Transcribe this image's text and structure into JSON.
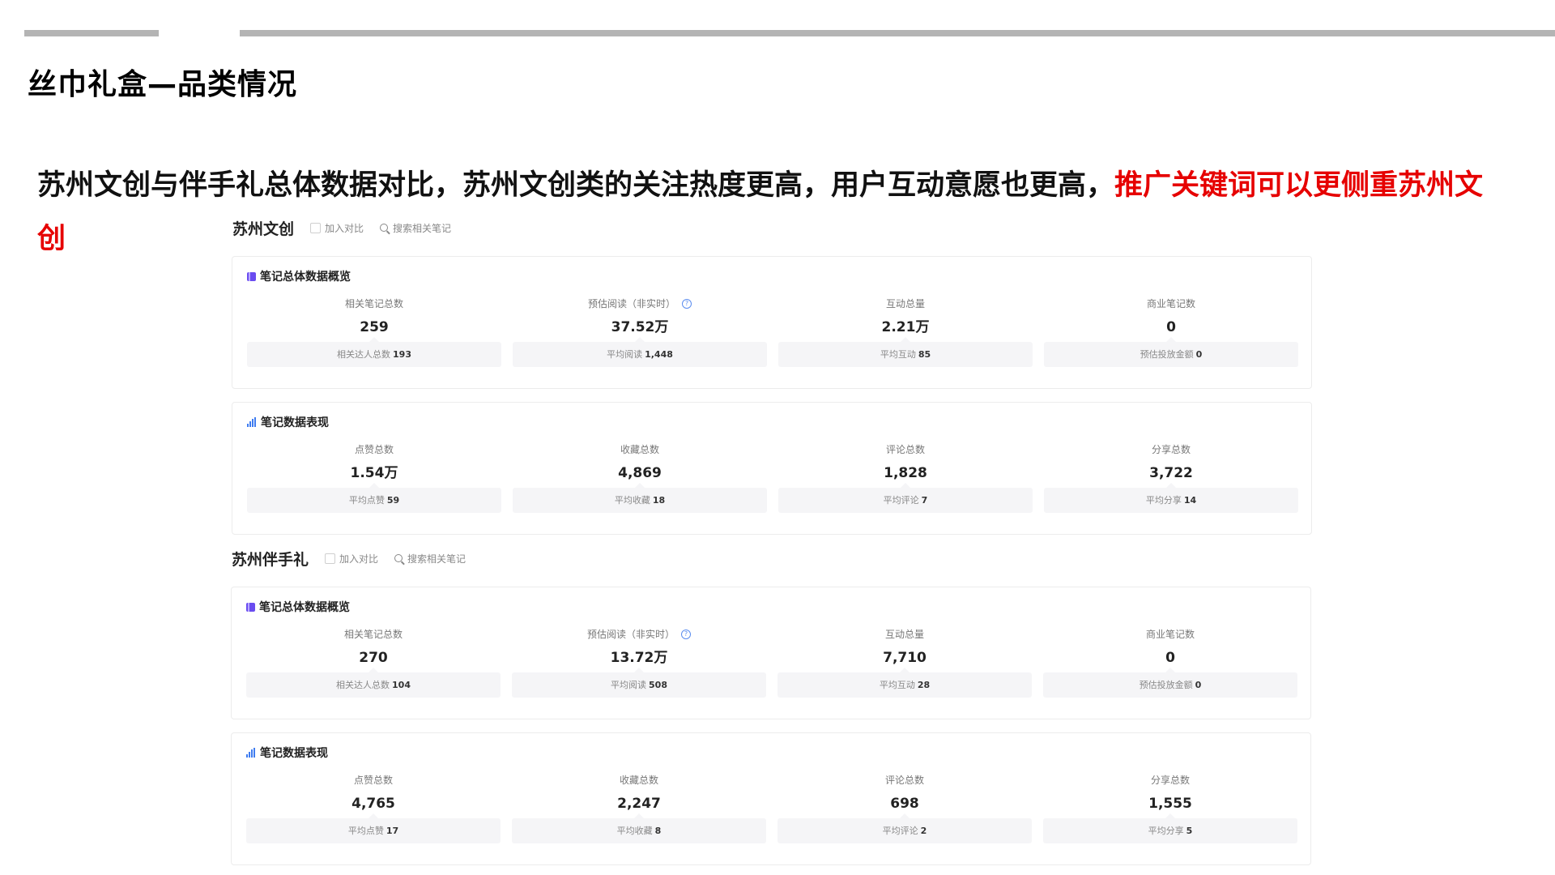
{
  "page_title": "丝巾礼盒—品类情况",
  "summary": {
    "text": "苏州文创与伴手礼总体数据对比，苏州文创类的关注热度更高，用户互动意愿也更高，",
    "highlight": "推广关键词可以更侧重苏州文创"
  },
  "colors": {
    "highlight": "#e60000",
    "overview_icon": "#6a4cf0",
    "performance_icon": "#3f7cf0",
    "top_bar": "#b4b4b4"
  },
  "brands": [
    {
      "name": "苏州文创",
      "compare_label": "加入对比",
      "search_label": "搜索相关笔记",
      "overview": {
        "title": "笔记总体数据概览",
        "metrics": [
          {
            "label": "相关笔记总数",
            "value": "259",
            "sub_label": "相关达人总数",
            "sub_value": "193"
          },
          {
            "label": "预估阅读（非实时）",
            "value": "37.52万",
            "sub_label": "平均阅读",
            "sub_value": "1,448",
            "help": "?"
          },
          {
            "label": "互动总量",
            "value": "2.21万",
            "sub_label": "平均互动",
            "sub_value": "85"
          },
          {
            "label": "商业笔记数",
            "value": "0",
            "sub_label": "预估投放金额",
            "sub_value": "0"
          }
        ]
      },
      "performance": {
        "title": "笔记数据表现",
        "metrics": [
          {
            "label": "点赞总数",
            "value": "1.54万",
            "sub_label": "平均点赞",
            "sub_value": "59"
          },
          {
            "label": "收藏总数",
            "value": "4,869",
            "sub_label": "平均收藏",
            "sub_value": "18"
          },
          {
            "label": "评论总数",
            "value": "1,828",
            "sub_label": "平均评论",
            "sub_value": "7"
          },
          {
            "label": "分享总数",
            "value": "3,722",
            "sub_label": "平均分享",
            "sub_value": "14"
          }
        ]
      }
    },
    {
      "name": "苏州伴手礼",
      "compare_label": "加入对比",
      "search_label": "搜索相关笔记",
      "overview": {
        "title": "笔记总体数据概览",
        "metrics": [
          {
            "label": "相关笔记总数",
            "value": "270",
            "sub_label": "相关达人总数",
            "sub_value": "104"
          },
          {
            "label": "预估阅读（非实时）",
            "value": "13.72万",
            "sub_label": "平均阅读",
            "sub_value": "508",
            "help": "?"
          },
          {
            "label": "互动总量",
            "value": "7,710",
            "sub_label": "平均互动",
            "sub_value": "28"
          },
          {
            "label": "商业笔记数",
            "value": "0",
            "sub_label": "预估投放金额",
            "sub_value": "0"
          }
        ]
      },
      "performance": {
        "title": "笔记数据表现",
        "metrics": [
          {
            "label": "点赞总数",
            "value": "4,765",
            "sub_label": "平均点赞",
            "sub_value": "17"
          },
          {
            "label": "收藏总数",
            "value": "2,247",
            "sub_label": "平均收藏",
            "sub_value": "8"
          },
          {
            "label": "评论总数",
            "value": "698",
            "sub_label": "平均评论",
            "sub_value": "2"
          },
          {
            "label": "分享总数",
            "value": "1,555",
            "sub_label": "平均分享",
            "sub_value": "5"
          }
        ]
      }
    }
  ]
}
